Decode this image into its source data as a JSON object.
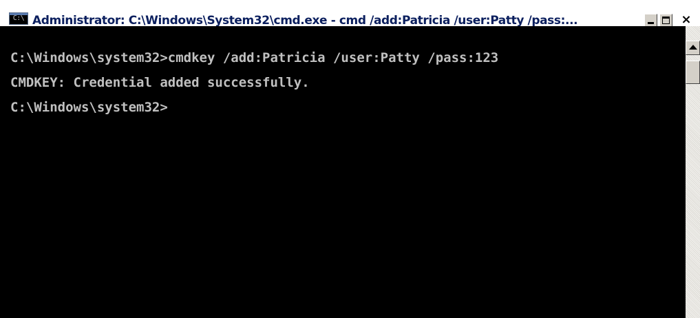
{
  "window": {
    "title": "Administrator: C:\\Windows\\System32\\cmd.exe - cmd  /add:Patricia /user:Patty /pass:...",
    "icon": "cmd-console-icon",
    "icon_text": "C:\\",
    "controls": {
      "minimize": "minimize",
      "maximize": "maximize",
      "close": "×"
    }
  },
  "console": {
    "lines": [
      "C:\\Windows\\system32>cmdkey /add:Patricia /user:Patty /pass:123",
      "CMDKEY: Credential added successfully.",
      "C:\\Windows\\system32>"
    ],
    "colors": {
      "background": "#000000",
      "text": "#c0c0c0"
    }
  },
  "scrollbar": {
    "up_icon": "arrow-up-icon"
  }
}
